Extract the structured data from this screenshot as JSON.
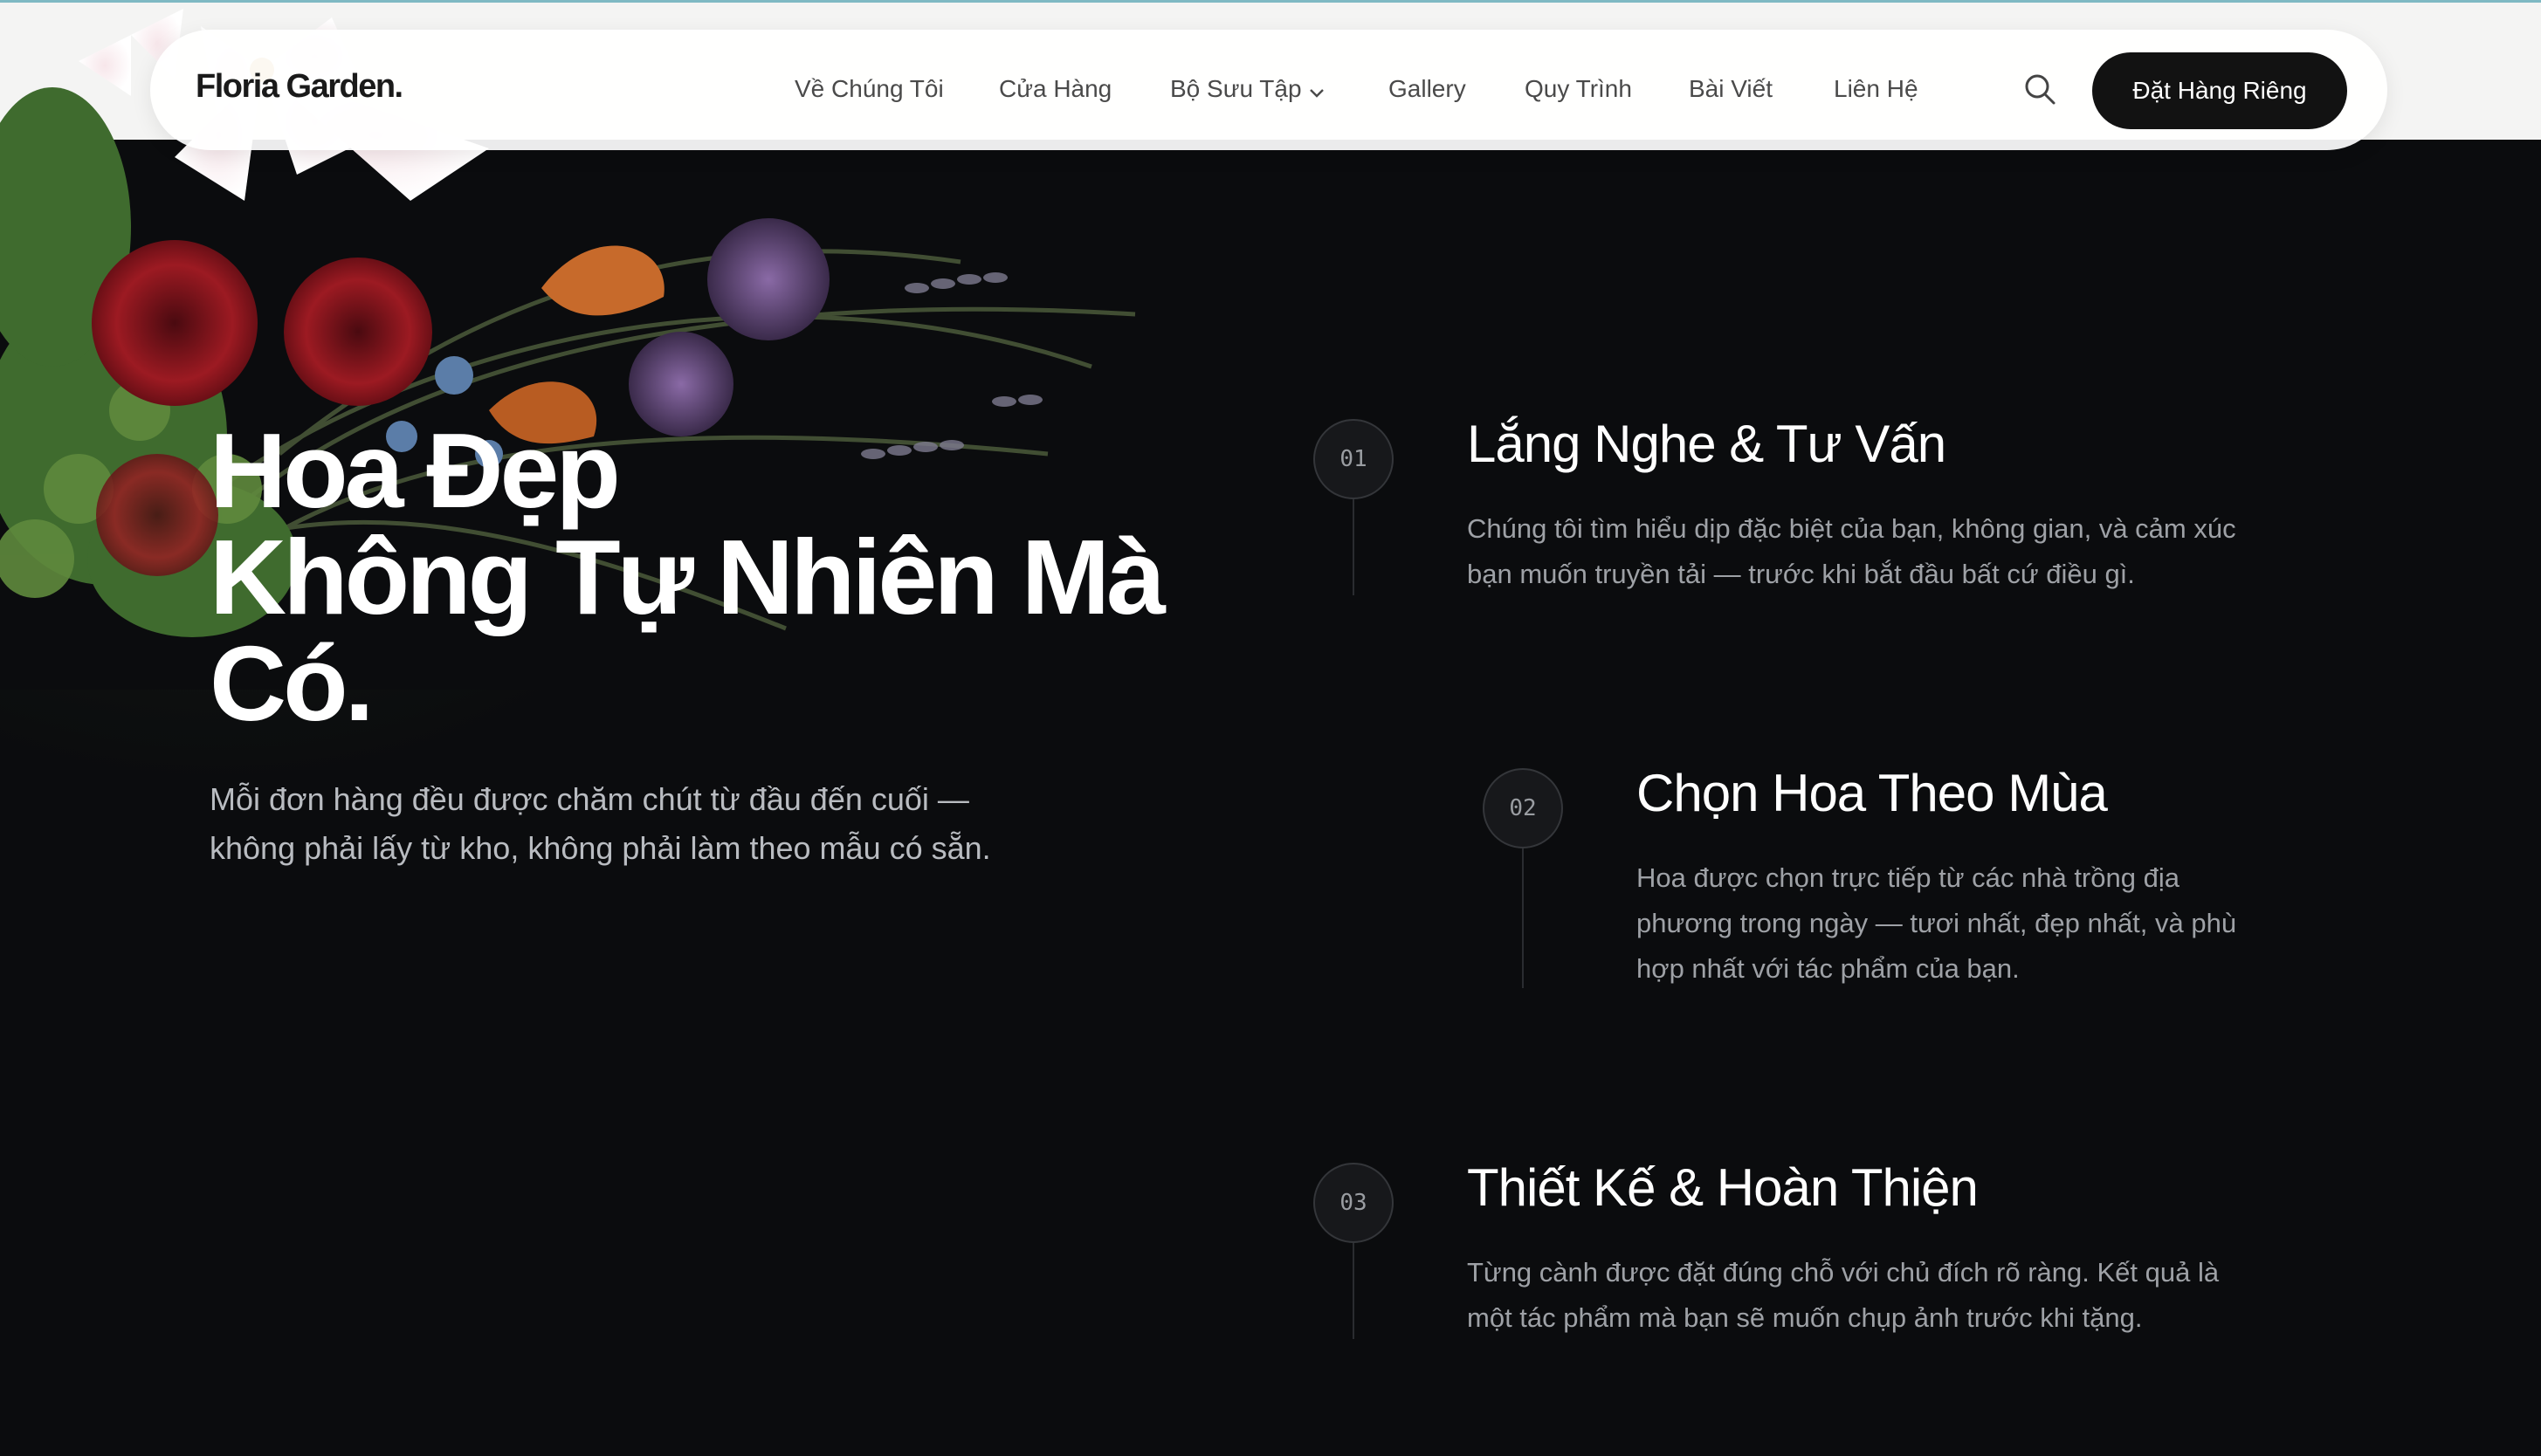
{
  "brand": {
    "logo": "Floria Garden."
  },
  "nav": {
    "items": [
      {
        "label": "Về Chúng Tôi"
      },
      {
        "label": "Cửa Hàng"
      },
      {
        "label": "Bộ Sưu Tập",
        "has_dropdown": true
      },
      {
        "label": "Gallery"
      },
      {
        "label": "Quy Trình"
      },
      {
        "label": "Bài Viết"
      },
      {
        "label": "Liên Hệ"
      }
    ],
    "search_icon": "search-icon",
    "cta_label": "Đặt Hàng Riêng"
  },
  "hero": {
    "title_lines": [
      "Hoa Đẹp",
      "Không Tự Nhiên Mà",
      "Có."
    ],
    "subtitle_lines": [
      "Mỗi đơn hàng đều được chăm chút từ đầu đến cuối —",
      "không phải lấy từ kho, không phải làm theo mẫu có sẵn."
    ]
  },
  "steps": [
    {
      "number": "01",
      "title": "Lắng Nghe & Tư Vấn",
      "description_lines": [
        "Chúng tôi tìm hiểu dịp đặc biệt của bạn, không gian, và cảm xúc",
        "bạn muốn truyền tải — trước khi bắt đầu bất cứ điều gì."
      ]
    },
    {
      "number": "02",
      "title": "Chọn Hoa Theo Mùa",
      "description_lines": [
        "Hoa được chọn trực tiếp từ các nhà trồng địa",
        "phương trong ngày — tươi nhất, đẹp nhất, và phù",
        "hợp nhất với tác phẩm của bạn."
      ]
    },
    {
      "number": "03",
      "title": "Thiết Kế & Hoàn Thiện",
      "description_lines": [
        "Từng cành được đặt đúng chỗ với chủ đích rõ ràng. Kết quả là",
        "một tác phẩm mà bạn sẽ muốn chụp ảnh trước khi tặng."
      ]
    }
  ],
  "colors": {
    "background": "#0b0c0e",
    "cta_background": "#121212",
    "nav_background": "#ffffff"
  }
}
